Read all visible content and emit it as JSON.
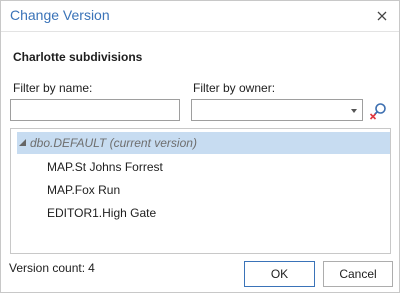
{
  "window": {
    "title": "Change Version"
  },
  "group_title": "Charlotte subdivisions",
  "filters": {
    "name_label": "Filter by name:",
    "name_value": "",
    "owner_label": "Filter by owner:",
    "owner_value": ""
  },
  "tree": {
    "root_label": "dbo.DEFAULT (current version)",
    "children": [
      "MAP.St Johns Forrest",
      "MAP.Fox Run",
      "EDITOR1.High Gate"
    ]
  },
  "footer": {
    "count_label": "Version count:",
    "count_value": "4",
    "ok_label": "OK",
    "cancel_label": "Cancel"
  },
  "colors": {
    "title": "#3a73b8",
    "selection": "#c7dcf1",
    "clear_icon": "#e0373f"
  }
}
